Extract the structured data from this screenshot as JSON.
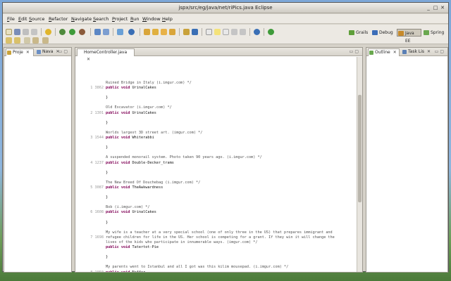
{
  "window": {
    "title": "jspx/src/eg/java/net/riPics.java Eclipse"
  },
  "menu": [
    {
      "mn": "F",
      "rest": "ile"
    },
    {
      "mn": "E",
      "rest": "dit"
    },
    {
      "mn": "S",
      "rest": "ource"
    },
    {
      "mn": "R",
      "rest": "efactor"
    },
    {
      "mn": "N",
      "rest": "avigate"
    },
    {
      "mn": "S",
      "rest": "earch"
    },
    {
      "mn": "P",
      "rest": "roject"
    },
    {
      "mn": "R",
      "rest": "un"
    },
    {
      "mn": "W",
      "rest": "indow"
    },
    {
      "mn": "H",
      "rest": "elp"
    }
  ],
  "perspectives": [
    {
      "label": "Grails",
      "color": "#5f9f3a"
    },
    {
      "label": "Debug",
      "color": "#3b6db8"
    },
    {
      "label": "Java EE",
      "color": "#c78a2a"
    },
    {
      "label": "Spring",
      "color": "#6aa84f"
    }
  ],
  "left_tabs": [
    {
      "label": "Proje",
      "color": "#c9a23a"
    },
    {
      "label": "Nava",
      "color": "#6b8fc4"
    }
  ],
  "editor_tab": {
    "label": "HomeController.java",
    "color": "#3b6db8"
  },
  "right_tabs": [
    {
      "label": "Outline",
      "color": "#6aa84f"
    },
    {
      "label": "Task Lis",
      "color": "#5a7fb5"
    }
  ],
  "close_glyph": "✕",
  "entries": [
    {
      "ln": "",
      "comment": [
        "Ruined Bridge in Italy (i.imgur.com) */"
      ],
      "sig": "public void UrinalCakes",
      "gap": 62
    },
    {
      "ln": "1 3862",
      "comment": [],
      "sig": "",
      "gap": 0
    },
    {
      "ln": "",
      "comment": [
        "Old Excavator (i.imgur.com) */"
      ],
      "sig": "public void UrinalCakes",
      "gap": 0
    },
    {
      "ln": "2 1301",
      "comment": [],
      "sig": "",
      "gap": 0
    },
    {
      "ln": "",
      "comment": [
        "Worlds largest 3D street art. (imgur.com) */"
      ],
      "sig": "public void Whiterabbi",
      "gap": 0
    },
    {
      "ln": "3 1544",
      "comment": [],
      "sig": "",
      "gap": 0
    },
    {
      "ln": "",
      "comment": [
        "A suspended monorail system. Photo taken 90 years ago. (i.imgur.com) */"
      ],
      "sig": "public void Double-Decker_trams",
      "gap": 0
    },
    {
      "ln": "4 1237",
      "comment": [],
      "sig": "",
      "gap": 0
    },
    {
      "ln": "",
      "comment": [
        "The New Breed Of Douchebag (i.imgur.com) */"
      ],
      "sig": "public void TheAwkwardness",
      "gap": 0
    },
    {
      "ln": "5 3087",
      "comment": [],
      "sig": "",
      "gap": 0
    },
    {
      "ln": "",
      "comment": [
        "Bob (i.imgur.com) */"
      ],
      "sig": "public void UrinalCakes",
      "gap": 0
    },
    {
      "ln": "6 1608",
      "comment": [],
      "sig": "",
      "gap": 0
    },
    {
      "ln": "",
      "comment": [
        "My wife is a teacher at a very special school (one of only three in the US) that prepares immigrant and",
        "refugee children for life in the US. Her school is competing for a grant. If they win it will change the",
        "lives of the kids who participate in innumerable ways. (imgur.com) */"
      ],
      "sig": "public void Tatertot-Pie",
      "gap": 0
    },
    {
      "ln": "7 1698",
      "comment": [],
      "sig": "",
      "gap": 0
    },
    {
      "ln": "",
      "comment": [
        "My parents went to Istanbul and all I got was this kilim mousepad. (i.imgur.com) */"
      ],
      "sig": "public void Naffer",
      "gap": 0
    },
    {
      "ln": "8 1050",
      "comment": [],
      "sig": "",
      "gap": 0
    },
    {
      "ln": "",
      "comment": [
        "Little Buddy (i.imgur.com) */"
      ],
      "sig": "",
      "gap": 0
    }
  ],
  "code_lines": [
    {
      "ln": "",
      "text": "Ruined Bridge in Italy (i.imgur.com) */",
      "kind": "cm"
    },
    {
      "ln": "1 3862",
      "text": "public void UrinalCakes",
      "kind": "sig"
    },
    {
      "ln": "",
      "text": "",
      "kind": "blank"
    },
    {
      "ln": "",
      "text": "}",
      "kind": "code"
    },
    {
      "ln": "",
      "text": "",
      "kind": "blank"
    },
    {
      "ln": "",
      "text": "Old Excavator (i.imgur.com) */",
      "kind": "cm"
    },
    {
      "ln": "2 1301",
      "text": "public void UrinalCakes",
      "kind": "sig"
    },
    {
      "ln": "",
      "text": "",
      "kind": "blank"
    },
    {
      "ln": "",
      "text": "}",
      "kind": "code"
    },
    {
      "ln": "",
      "text": "",
      "kind": "blank"
    },
    {
      "ln": "",
      "text": "Worlds largest 3D street art. (imgur.com) */",
      "kind": "cm"
    },
    {
      "ln": "3 1544",
      "text": "public void Whiterabbi",
      "kind": "sig"
    },
    {
      "ln": "",
      "text": "",
      "kind": "blank"
    },
    {
      "ln": "",
      "text": "}",
      "kind": "code"
    },
    {
      "ln": "",
      "text": "",
      "kind": "blank"
    },
    {
      "ln": "",
      "text": "A suspended monorail system. Photo taken 90 years ago. (i.imgur.com) */",
      "kind": "cm"
    },
    {
      "ln": "4 1237",
      "text": "public void Double-Decker_trams",
      "kind": "sig"
    },
    {
      "ln": "",
      "text": "",
      "kind": "blank"
    },
    {
      "ln": "",
      "text": "}",
      "kind": "code"
    },
    {
      "ln": "",
      "text": "",
      "kind": "blank"
    },
    {
      "ln": "",
      "text": "The New Breed Of Douchebag (i.imgur.com) */",
      "kind": "cm"
    },
    {
      "ln": "5 3087",
      "text": "public void TheAwkwardness",
      "kind": "sig"
    },
    {
      "ln": "",
      "text": "",
      "kind": "blank"
    },
    {
      "ln": "",
      "text": "}",
      "kind": "code"
    },
    {
      "ln": "",
      "text": "",
      "kind": "blank"
    },
    {
      "ln": "",
      "text": "Bob (i.imgur.com) */",
      "kind": "cm"
    },
    {
      "ln": "6 1608",
      "text": "public void UrinalCakes",
      "kind": "sig"
    },
    {
      "ln": "",
      "text": "",
      "kind": "blank"
    },
    {
      "ln": "",
      "text": "}",
      "kind": "code"
    },
    {
      "ln": "",
      "text": "",
      "kind": "blank"
    },
    {
      "ln": "",
      "text": "My wife is a teacher at a very special school (one of only three in the US) that prepares immigrant and",
      "kind": "cm"
    },
    {
      "ln": "7 1698",
      "text": "refugee children for life in the US. Her school is competing for a grant. If they win it will change the",
      "kind": "cm"
    },
    {
      "ln": "",
      "text": "lives of the kids who participate in innumerable ways. (imgur.com) */",
      "kind": "cm"
    },
    {
      "ln": "",
      "text": "public void Tatertot-Pie",
      "kind": "sig"
    },
    {
      "ln": "",
      "text": "",
      "kind": "blank"
    },
    {
      "ln": "",
      "text": "}",
      "kind": "code"
    },
    {
      "ln": "",
      "text": "",
      "kind": "blank"
    },
    {
      "ln": "",
      "text": "My parents went to Istanbul and all I got was this kilim mousepad. (i.imgur.com) */",
      "kind": "cm"
    },
    {
      "ln": "8 1050",
      "text": "public void Naffer",
      "kind": "sig"
    },
    {
      "ln": "",
      "text": "",
      "kind": "blank"
    },
    {
      "ln": "",
      "text": "}",
      "kind": "code"
    },
    {
      "ln": "",
      "text": "",
      "kind": "blank"
    },
    {
      "ln": "",
      "text": "Little Buddy (i.imgur.com) */",
      "kind": "cm"
    }
  ],
  "scroll_fraction": 0.35
}
